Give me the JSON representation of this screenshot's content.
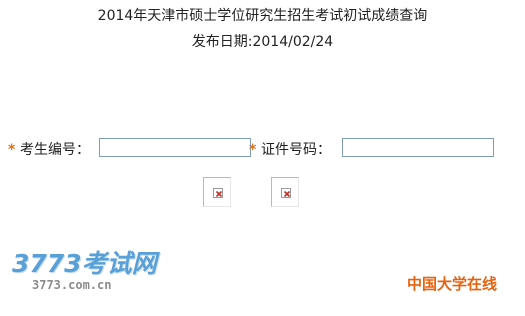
{
  "header": {
    "title": "2014年天津市硕士学位研究生招生考试初试成绩查询",
    "publish_date": "发布日期:2014/02/24"
  },
  "form": {
    "required_mark": "*",
    "exam_number_label": "考生编号：",
    "exam_number_value": "",
    "id_number_label": "证件号码：",
    "id_number_value": ""
  },
  "buttons": [
    {
      "icon": "broken-image-icon"
    },
    {
      "icon": "broken-image-icon"
    }
  ],
  "watermark": {
    "logo_text": "3773考试网",
    "logo_url_text": "3773.com.cn"
  },
  "brand": {
    "text": "中国大学在线"
  },
  "colors": {
    "required_mark": "#e07010",
    "input_border": "#7f9db9",
    "logo_blue": "#5aa0d8",
    "brand_orange": "#e8620e"
  }
}
